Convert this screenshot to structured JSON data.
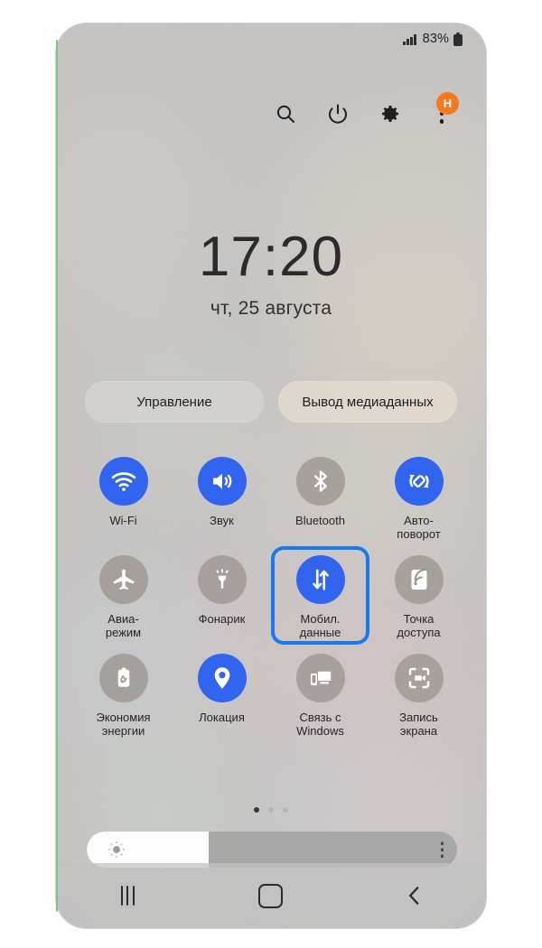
{
  "status_bar": {
    "signal_icon": "signal-bars-icon",
    "battery_percent": "83%",
    "battery_icon": "battery-icon"
  },
  "header": {
    "icons": [
      {
        "name": "search-icon",
        "label": "Поиск"
      },
      {
        "name": "power-icon",
        "label": "Питание"
      },
      {
        "name": "settings-gear-icon",
        "label": "Настройки"
      }
    ],
    "menu_icon": "more-options-kebab-icon",
    "avatar_letter": "H"
  },
  "clock": {
    "time": "17:20",
    "date": "чт, 25 августа"
  },
  "pills": [
    {
      "label": "Управление"
    },
    {
      "label": "Вывод медиаданных"
    }
  ],
  "tiles": [
    {
      "label": "Wi-Fi",
      "icon": "wifi-icon",
      "active": true,
      "selected": false
    },
    {
      "label": "Звук",
      "icon": "sound-icon",
      "active": true,
      "selected": false
    },
    {
      "label": "Bluetooth",
      "icon": "bluetooth-icon",
      "active": false,
      "selected": false
    },
    {
      "label": "Авто-\nповорот",
      "icon": "auto-rotate-icon",
      "active": true,
      "selected": false
    },
    {
      "label": "Авиа-\nрежим",
      "icon": "airplane-icon",
      "active": false,
      "selected": false
    },
    {
      "label": "Фонарик",
      "icon": "flashlight-icon",
      "active": false,
      "selected": false
    },
    {
      "label": "Мобил.\nданные",
      "icon": "mobile-data-icon",
      "active": true,
      "selected": true
    },
    {
      "label": "Точка\nдоступа",
      "icon": "hotspot-icon",
      "active": false,
      "selected": false
    },
    {
      "label": "Экономия\nэнергии",
      "icon": "battery-saver-icon",
      "active": false,
      "selected": false
    },
    {
      "label": "Локация",
      "icon": "location-pin-icon",
      "active": true,
      "selected": false
    },
    {
      "label": "Связь с\nWindows",
      "icon": "link-to-windows-icon",
      "active": false,
      "selected": false
    },
    {
      "label": "Запись\nэкрана",
      "icon": "screen-record-icon",
      "active": false,
      "selected": false
    }
  ],
  "page_dots": {
    "count": 3,
    "active_index": 0
  },
  "brightness": {
    "value_percent": 33,
    "sun_icon": "brightness-sun-icon",
    "menu_icon": "brightness-options-kebab-icon"
  },
  "nav_bar": {
    "recents_label": "recents-button",
    "home_label": "home-button",
    "back_label": "back-button"
  },
  "colors": {
    "accent_blue": "#3165ef",
    "selection_blue": "#1878f0",
    "avatar_orange": "#f4791f",
    "tile_off_gray": "#98928c"
  }
}
